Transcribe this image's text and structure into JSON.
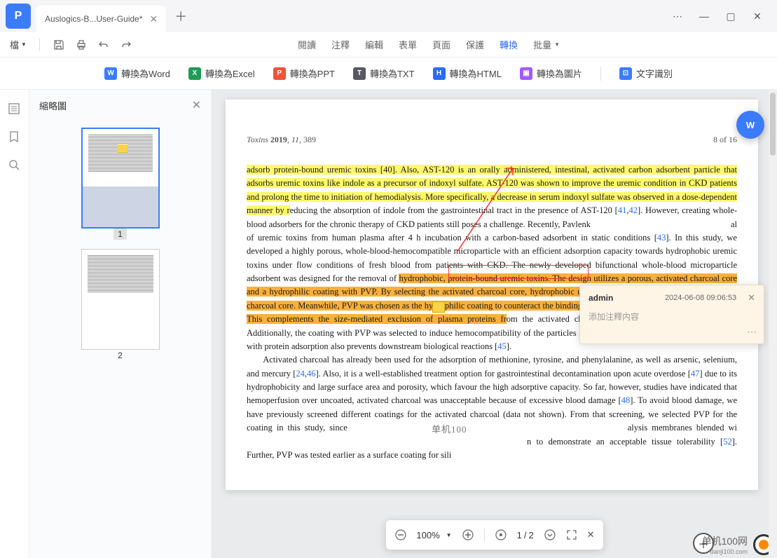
{
  "titlebar": {
    "tab_name": "Auslogics-B...User-Guide*"
  },
  "menubar": {
    "file": "檔",
    "items": [
      "閱讀",
      "注釋",
      "編輯",
      "表單",
      "頁面",
      "保護",
      "轉換",
      "批量"
    ],
    "active_index": 6
  },
  "toolbar": {
    "convert_word": "轉換為Word",
    "convert_excel": "轉換為Excel",
    "convert_ppt": "轉換為PPT",
    "convert_txt": "轉換為TXT",
    "convert_html": "轉換為HTML",
    "convert_img": "轉換為圖片",
    "ocr": "文字識別"
  },
  "thumbnails": {
    "title": "縮略圖",
    "pages": [
      "1",
      "2"
    ]
  },
  "page": {
    "header_left": "Toxins 2019, 11, 389",
    "header_right": "8 of 16",
    "para1_hl": "adsorb protein-bound uremic toxins [40]. Also, AST-120 is an orally administered, intestinal, activated carbon adsorbent particle that adsorbs uremic toxins like indole as a precursor of indoxyl sulfate. AST-120 was shown to improve the uremic condition in CKD patients and prolong the time to initiation of hemodialysis. More specifically, a decrease in serum indoxyl sulfate was observed in a dose-dependent manner by r",
    "para1_rest": "educing the absorption of indole from the gastrointestinal tract in the presence of AST-120 [",
    "ref41": "41",
    "ref42": "42",
    "para1_rest2": "]. However, creating whole-blood adsorbers for the chronic therapy of CKD patients still poses a challenge. Recently, Pavlenk",
    "para1_rest3": "al of uremic toxins from human plasma after 4 h incubation with a carbon-based adsorbent in static conditions [",
    "ref43": "43",
    "para1_rest4": "]. In this study, we developed a highly porous, whole-blood-hemocompatible microparticle with an efficient adsorption capacity towards hydrophobic uremic toxins under flow conditions of fresh blood from patients with CKD. The newly developed bifunctional whole-blood microparticle adsorbent was designed for the removal of ",
    "para1_hl2": "hydrophobic, protein-bound uremic toxins. The design utilizes a porous, activated charcoal core and a hydrophilic coating with PVP. By selecting the activated charcoal core, hydrophobic uremic toxins may diffuse into the activated charcoal core. Meanwhile, PVP was chosen as the hydrophilic coating to counteract the binding of plasma proteins to the hydrophobic core. This complements the size-mediated exclusion of plasma proteins fr",
    "para1_rest5": "om the activated charcoal core by pore size of the particle. Additionally, the coating with PVP was selected to induce hemocompatibility of the particles for whole-blood applications, as interference with protein adsorption also prevents downstream biological reactions [",
    "ref45": "45",
    "para1_rest6": "].",
    "para2": "Activated charcoal has already been used for the adsorption of methionine, tyrosine, and phenylalanine, as well as arsenic, selenium, and mercury [",
    "ref24": "24",
    "ref46": "46",
    "para2b": "]. Also, it is a well-established treatment option for gastrointestinal decontamination upon acute overdose [",
    "ref47": "47",
    "para2c": "] due to its hydrophobicity and large surface area and porosity, which favour the high adsorptive capacity. So far, however, studies have indicated that hemoperfusion over uncoated, activated charcoal was unacceptable because of excessive blood damage [",
    "ref48": "48",
    "para2d": "]. To avoid blood damage, we have previously screened different coatings for the activated charcoal (data not shown). From that screening, we selected PVP for the coating in this study, since",
    "para2e": "alysis membranes blended wi",
    "para2f": "n to demonstrate an acceptable tissue tolerability [",
    "ref52": "52",
    "para2g": "].  Further, PVP was tested earlier as a surface coating for sili",
    "watermark": "单机100"
  },
  "popup": {
    "user": "admin",
    "time": "2024-06-08 09:06:53",
    "placeholder": "添加注釋内容"
  },
  "bottombar": {
    "zoom": "100%",
    "page_cur": "1",
    "page_sep": "/",
    "page_total": "2"
  },
  "record": {
    "label": "单机100网",
    "sub": "danji100.com"
  }
}
